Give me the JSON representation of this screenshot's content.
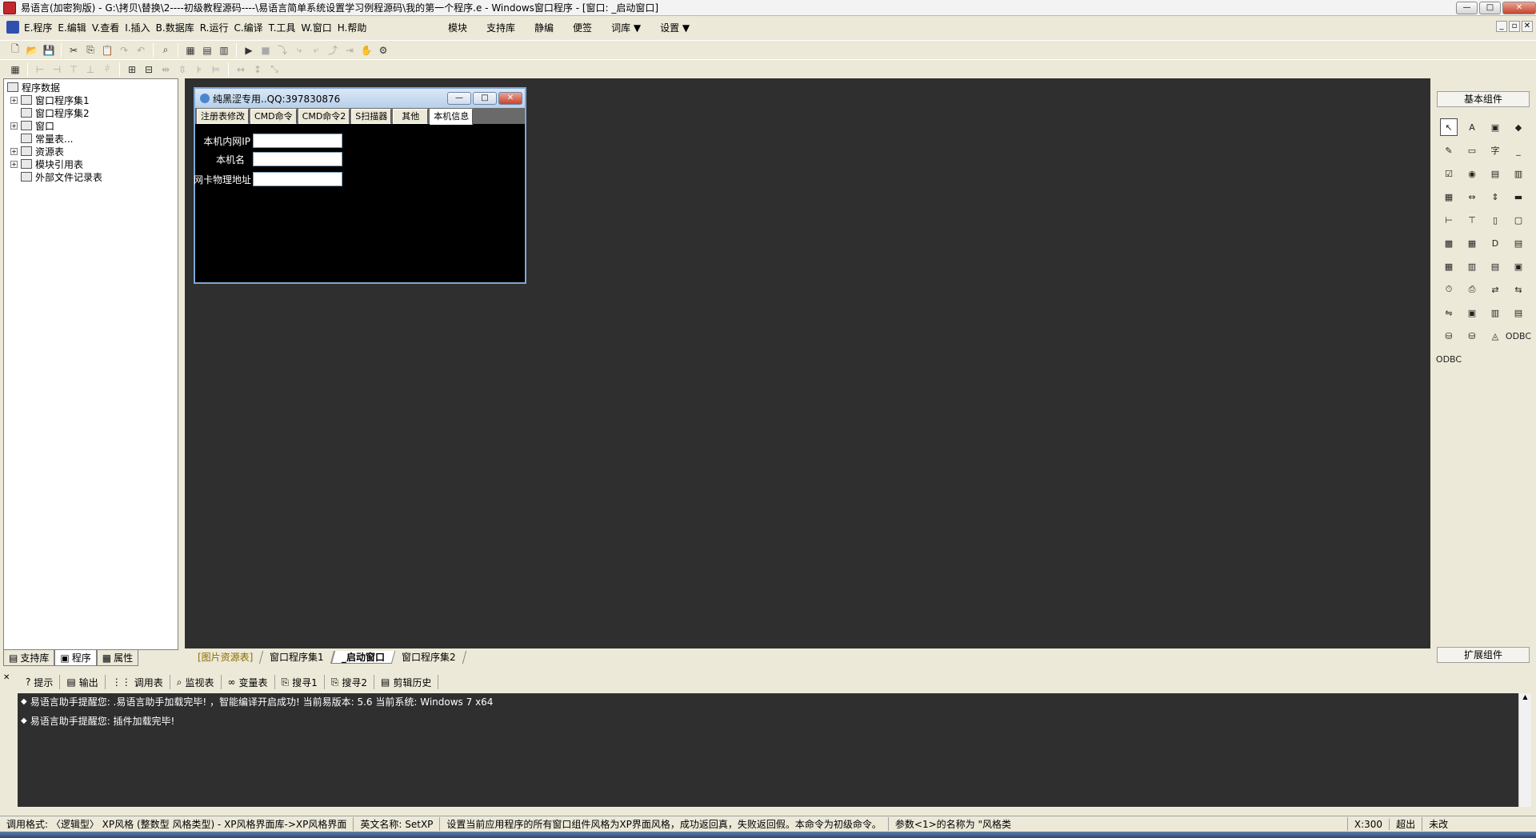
{
  "window": {
    "title": "易语言(加密狗版) - G:\\拷贝\\替换\\2----初级教程源码----\\易语言简单系统设置学习例程源码\\我的第一个程序.e - Windows窗口程序 - [窗口: _启动窗口]",
    "min": "—",
    "max": "□",
    "close": "✕"
  },
  "menu": {
    "items": [
      "E.程序",
      "E.编辑",
      "V.查看",
      "I.插入",
      "B.数据库",
      "R.运行",
      "C.编译",
      "T.工具",
      "W.窗口",
      "H.帮助"
    ],
    "right": [
      "模块",
      "支持库",
      "静编",
      "便签",
      "词库 ▼",
      "设置 ▼"
    ]
  },
  "left_panel": {
    "tree": [
      {
        "label": "程序数据",
        "level": 0,
        "expander": ""
      },
      {
        "label": "窗口程序集1",
        "level": 1,
        "expander": "+"
      },
      {
        "label": "窗口程序集2",
        "level": 1,
        "expander": ""
      },
      {
        "label": "窗口",
        "level": 1,
        "expander": "+"
      },
      {
        "label": "常量表...",
        "level": 1,
        "expander": ""
      },
      {
        "label": "资源表",
        "level": 1,
        "expander": "+"
      },
      {
        "label": "模块引用表",
        "level": 1,
        "expander": "+"
      },
      {
        "label": "外部文件记录表",
        "level": 1,
        "expander": ""
      }
    ],
    "tabs": [
      "支持库",
      "程序",
      "属性"
    ]
  },
  "design_window": {
    "title": "纯黑涩专用..QQ:397830876",
    "tabs": [
      "注册表修改",
      "CMD命令",
      "CMD命令2",
      "S扫描器",
      "其他",
      "本机信息"
    ],
    "active_tab": "本机信息",
    "fields": [
      {
        "label": "本机内网IP",
        "value": ""
      },
      {
        "label": "本机名",
        "value": ""
      },
      {
        "label": "网卡物理地址",
        "value": ""
      }
    ]
  },
  "center_tabs": [
    "[图片资源表]",
    "窗口程序集1",
    "_启动窗口",
    "窗口程序集2"
  ],
  "right_panel": {
    "header": "基本组件",
    "footer": "扩展组件",
    "components": [
      "pointer-icon",
      "label-icon",
      "picture-icon",
      "shape-icon",
      "edit-icon",
      "frame-icon",
      "text-icon",
      "line-icon",
      "checkbox-icon",
      "radio-icon",
      "listbox-icon",
      "combobox-icon",
      "table-icon",
      "scroll-icon",
      "vscroll-icon",
      "progress-icon",
      "hslider-icon",
      "vslider-icon",
      "tab-icon",
      "panel-icon",
      "datetime-icon",
      "calendar-icon",
      "folder-icon",
      "file-icon",
      "color-icon",
      "font-icon",
      "print-icon",
      "report-icon",
      "timer-icon",
      "printer-icon",
      "data-icon",
      "network-icon",
      "client-icon",
      "server-icon",
      "window-icon",
      "chart-icon",
      "db-icon",
      "db2-icon",
      "graph-icon",
      "odbc-icon",
      "odbc2-icon"
    ],
    "glyphs": [
      "↖",
      "A",
      "▣",
      "◆",
      "✎",
      "▭",
      "字",
      "_",
      "☑",
      "◉",
      "▤",
      "▥",
      "▦",
      "⇔",
      "⇕",
      "▬",
      "⊢",
      "⊤",
      "▯",
      "▢",
      "▩",
      "▦",
      "D",
      "▤",
      "▦",
      "▥",
      "▤",
      "▣",
      "⏱",
      "⎙",
      "⇄",
      "⇆",
      "⇋",
      "▣",
      "▥",
      "▤",
      "⛁",
      "⛁",
      "◬",
      "ODBC",
      "ODBC"
    ]
  },
  "bottom_tabs": [
    {
      "icon": "?",
      "label": "提示"
    },
    {
      "icon": "▤",
      "label": "输出"
    },
    {
      "icon": "⋮⋮",
      "label": "调用表"
    },
    {
      "icon": "⌕",
      "label": "监视表"
    },
    {
      "icon": "∞",
      "label": "变量表"
    },
    {
      "icon": "⎘",
      "label": "搜寻1"
    },
    {
      "icon": "⎘",
      "label": "搜寻2"
    },
    {
      "icon": "▤",
      "label": "剪辑历史"
    }
  ],
  "output": {
    "lines": [
      "易语言助手提醒您: .易语言助手加载完毕! ，智能编译开启成功!  当前易版本: 5.6  当前系统: Windows 7 x64",
      "易语言助手提醒您: 插件加载完毕!"
    ]
  },
  "status": {
    "segments": [
      "调用格式: 〈逻辑型〉 XP风格 (整数型 风格类型) - XP风格界面库->XP风格界面",
      "英文名称: SetXP",
      "设置当前应用程序的所有窗口组件风格为XP界面风格，成功返回真，失败返回假。本命令为初级命令。",
      "参数<1>的名称为 \"风格类",
      "X:300",
      "超出",
      "未改"
    ]
  }
}
